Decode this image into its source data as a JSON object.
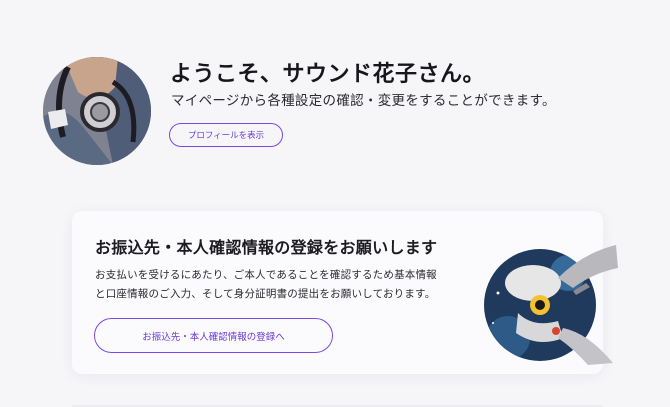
{
  "user": {
    "welcome_title": "ようこそ、サウンド花子さん。",
    "welcome_sub": "マイページから各種設定の確認・変更をすることができます。",
    "profile_button": "プロフィールを表示"
  },
  "notice": {
    "title": "お振込先・本人確認情報の登録をお願いします",
    "body_lines": [
      "お支払いを受けるにあたり、ご本人であることを確認するため基本情報",
      "と口座情報のご入力、そして身分証明書の提出をお願いしております。"
    ],
    "button": "お振込先・本人確認情報の登録へ"
  },
  "colors": {
    "accent": "#7a4ae0",
    "background": "#f6f6f9",
    "card": "#fbfbfd"
  },
  "icons": {
    "avatar": "user-avatar-headphones",
    "illustration": "collage-illustration"
  }
}
